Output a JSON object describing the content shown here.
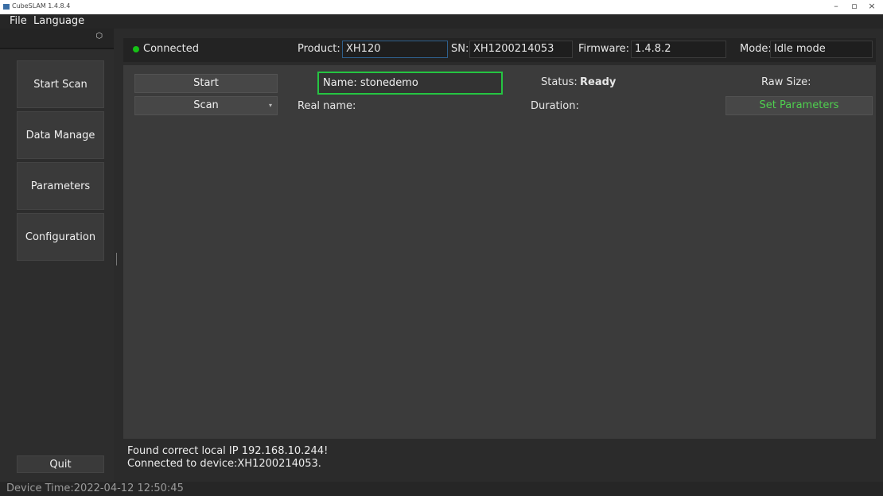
{
  "window": {
    "title": "CubeSLAM 1.4.8.4",
    "minimize_glyph": "–",
    "restore_glyph": "▫",
    "close_glyph": "×"
  },
  "menu": {
    "file": "File",
    "language": "Language"
  },
  "sidebar": {
    "float_glyph": "⬡",
    "items": [
      {
        "label": "Start Scan"
      },
      {
        "label": "Data Manage"
      },
      {
        "label": "Parameters"
      },
      {
        "label": "Configuration"
      }
    ],
    "quit_label": "Quit"
  },
  "info": {
    "connection_status": "Connected",
    "product_label": "Product:",
    "product_value": "XH120",
    "sn_label": "SN:",
    "sn_value": "XH1200214053",
    "firmware_label": "Firmware:",
    "firmware_value": "1.4.8.2",
    "mode_label": "Mode:",
    "mode_value": "Idle mode"
  },
  "scan": {
    "start_label": "Start",
    "scan_mode_value": "Scan",
    "dropdown_glyph": "▾",
    "name_label": "Name:",
    "name_value": "stonedemo",
    "real_name_label": "Real name:",
    "status_label": "Status:",
    "status_value": "Ready",
    "duration_label": "Duration:",
    "raw_size_label": "Raw Size:",
    "set_parameters_label": "Set Parameters"
  },
  "log": {
    "lines": [
      "Found correct local IP 192.168.10.244!",
      "Connected to device:XH1200214053."
    ]
  },
  "status_bar": {
    "device_time": "Device Time:2022-04-12 12:50:45"
  },
  "colors": {
    "connected_dot": "#16c116",
    "name_highlight": "#25c442",
    "set_parameters_text": "#4fd04f"
  }
}
